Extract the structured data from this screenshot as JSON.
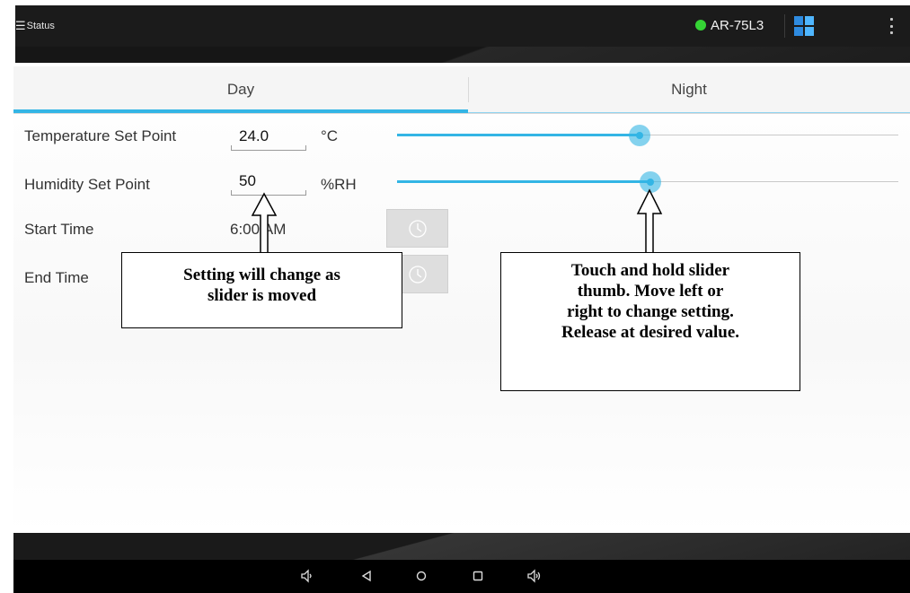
{
  "action_bar": {
    "menu_label": "Status",
    "menu_icon": "hamburger-menu-icon",
    "device_name": "AR-75L3",
    "status_color": "#35d435",
    "grid_colors": [
      "#2e8be0",
      "#4fb6ff",
      "#2e8be0",
      "#4fb6ff"
    ]
  },
  "tabs": [
    {
      "label": "Day",
      "selected": true
    },
    {
      "label": "Night",
      "selected": false
    }
  ],
  "settings": {
    "temperature": {
      "label": "Temperature Set Point",
      "value": "24.0",
      "unit": "°C",
      "slider_fraction": 0.483
    },
    "humidity": {
      "label": "Humidity Set Point",
      "value": "50",
      "unit": "%RH",
      "slider_fraction": 0.505
    },
    "start_time": {
      "label": "Start Time",
      "value": "6:00 AM"
    },
    "end_time": {
      "label": "End Time"
    }
  },
  "callouts": {
    "left": [
      "Setting will change as",
      "slider is moved"
    ],
    "right": [
      "Touch and hold slider",
      "thumb.  Move left or",
      "right to change setting.",
      "Release at desired value."
    ]
  },
  "nav_icons": [
    "volume-down-icon",
    "back-icon",
    "home-icon",
    "recents-icon",
    "volume-up-icon"
  ],
  "colors": {
    "accent": "#33b5e5",
    "bar": "#1b1b1b"
  }
}
